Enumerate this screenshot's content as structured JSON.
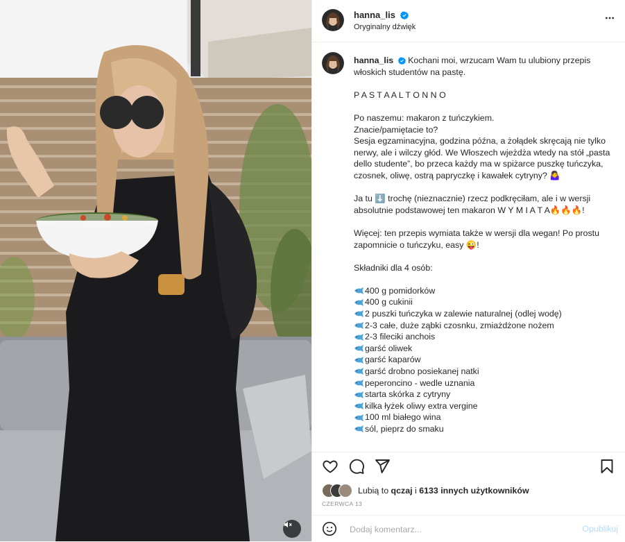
{
  "author": {
    "username": "hanna_lis",
    "verified": true,
    "audio_label": "Oryginalny dźwięk"
  },
  "caption": {
    "lines": [
      "Kochani moi, wrzucam Wam tu ulubiony przepis włoskich studentów na pastę.",
      "",
      "P A S T A  A L  T O N N O",
      "",
      "Po naszemu: makaron z tuńczykiem.",
      "Znacie/pamiętacie to?",
      "Sesja egzaminacyjna, godzina późna, a żołądek skręcają nie tylko nerwy, ale i wilczy głód. We Włoszech wjeżdża wtedy na stół „pasta dello studente”, bo przeca każdy ma w spiżarce puszkę tuńczyka, czosnek, oliwę, ostrą papryczkę i kawałek cytryny? 🤷‍♀️",
      "",
      "Ja tu ⬇️ trochę (nieznacznie) rzecz podkręciłam, ale i w wersji absolutnie podstawowej ten makaron W Y M I A T A🔥🔥🔥!",
      "",
      "Więcej: ten przepis wymiata także w wersji dla wegan! Po prostu zapomnicie o tuńczyku, easy 😜!",
      "",
      "Składniki dla 4 osób:",
      ""
    ],
    "ingredients": [
      "400 g pomidorków",
      "400 g cukinii",
      "2 puszki tuńczyka w zalewie naturalnej (odlej wodę)",
      "2-3 całe, duże ząbki czosnku, zmiażdżone nożem",
      "2-3 fileciki anchois",
      "garść oliwek",
      "garść kaparów",
      "garść drobno posiekanej natki",
      "peperoncino - wedle uznania",
      "starta skórka z cytryny",
      "kilka łyżek oliwy extra vergine",
      "100 ml białego wina",
      "sól, pieprz do smaku"
    ]
  },
  "likes": {
    "prefix": "Lubią to",
    "first_liker": "qczaj",
    "connector": "i",
    "others": "6133 innych użytkowników"
  },
  "date_label": "CZERWCA 13",
  "comment": {
    "placeholder": "Dodaj komentarz...",
    "publish_label": "Opublikuj"
  },
  "icons": {
    "more": "more-horizontal-icon",
    "like": "heart-icon",
    "comment": "comment-icon",
    "share": "paper-plane-icon",
    "save": "bookmark-icon",
    "emoji": "smiley-icon",
    "mute": "speaker-muted-icon",
    "verified": "verified-badge-icon",
    "bullet": "fish-icon"
  },
  "colors": {
    "verified_blue": "#0095f6",
    "text": "#262626",
    "muted": "#8e8e8e",
    "publish_disabled": "#b3dbff",
    "divider": "#efefef"
  }
}
